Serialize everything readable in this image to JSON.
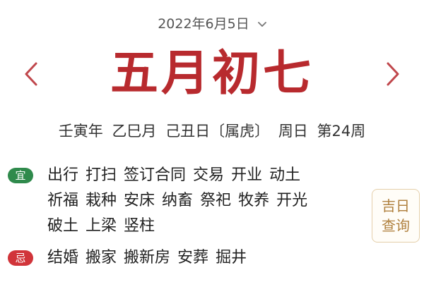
{
  "header": {
    "solar_date": "2022年6月5日",
    "dropdown_icon": "chevron-down-icon",
    "prev_icon": "chevron-left-icon",
    "next_icon": "chevron-right-icon"
  },
  "lunar": {
    "date": "五月初七"
  },
  "ganzhi": {
    "year": "壬寅年",
    "month": "乙巳月",
    "day": "己丑日",
    "zodiac": "〔属虎〕",
    "weekday": "周日",
    "week": "第24周"
  },
  "yi": {
    "label": "宜",
    "items": [
      "出行",
      "打扫",
      "签订合同",
      "交易",
      "开业",
      "动土",
      "祈福",
      "栽种",
      "安床",
      "纳畜",
      "祭祀",
      "牧养",
      "开光",
      "破土",
      "上梁",
      "竖柱"
    ]
  },
  "ji": {
    "label": "忌",
    "items": [
      "结婚",
      "搬家",
      "搬新房",
      "安葬",
      "掘井"
    ]
  },
  "auspicious_button": {
    "line1": "吉日",
    "line2": "查询"
  },
  "colors": {
    "lunar_red": "#b82a2e",
    "arrow_red": "#c0474c",
    "yi_green": "#2f8a4c",
    "ji_red": "#d1343a",
    "button_gold": "#b0813f"
  }
}
